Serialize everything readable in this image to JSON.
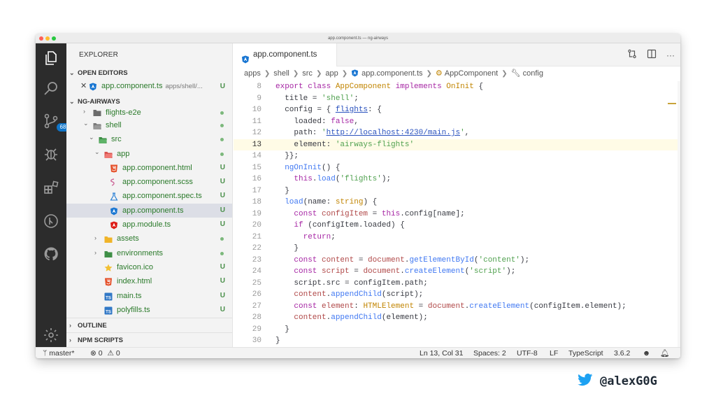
{
  "window": {
    "title": "app.component.ts — ng-airways"
  },
  "activity_bar": {
    "scm_badge": "68"
  },
  "sidebar": {
    "title": "EXPLORER",
    "open_editors": {
      "header": "OPEN EDITORS",
      "items": [
        {
          "close": "✕",
          "name": "app.component.ts",
          "path": "apps/shell/...",
          "status": "U"
        }
      ]
    },
    "project": {
      "header": "NG-AIRWAYS",
      "rows": [
        {
          "name": "flights-e2e",
          "chev": "›",
          "type": "folder"
        },
        {
          "name": "shell",
          "chev": "⌄",
          "type": "folder-open"
        },
        {
          "name": "src",
          "chev": "⌄",
          "type": "folder-open-src"
        },
        {
          "name": "app",
          "chev": "⌄",
          "type": "folder-app"
        },
        {
          "name": "app.component.html",
          "type": "html",
          "status": "U"
        },
        {
          "name": "app.component.scss",
          "type": "scss",
          "status": "U"
        },
        {
          "name": "app.component.spec.ts",
          "type": "spec",
          "status": "U"
        },
        {
          "name": "app.component.ts",
          "type": "angular-ts",
          "status": "U",
          "selected": true
        },
        {
          "name": "app.module.ts",
          "type": "angular",
          "status": "U"
        },
        {
          "name": "assets",
          "chev": "›",
          "type": "folder-assets"
        },
        {
          "name": "environments",
          "chev": "›",
          "type": "folder-env"
        },
        {
          "name": "favicon.ico",
          "type": "favicon",
          "status": "U"
        },
        {
          "name": "index.html",
          "type": "html",
          "status": "U"
        },
        {
          "name": "main.ts",
          "type": "ts",
          "status": "U"
        },
        {
          "name": "polyfills.ts",
          "type": "ts",
          "status": "U"
        }
      ]
    },
    "outline": "OUTLINE",
    "npm_scripts": "NPM SCRIPTS"
  },
  "editor": {
    "tab": {
      "label": "app.component.ts"
    },
    "breadcrumb": [
      "apps",
      "shell",
      "src",
      "app",
      "app.component.ts",
      "AppComponent",
      "config"
    ],
    "current_line": 13,
    "lines": [
      {
        "n": "8",
        "tokens": [
          [
            "kw",
            "export class "
          ],
          [
            "cls",
            "AppComponent "
          ],
          [
            "kw",
            "implements "
          ],
          [
            "cls",
            "OnInit"
          ],
          [
            "p",
            " {"
          ]
        ]
      },
      {
        "n": "9",
        "tokens": [
          [
            "p",
            "  title = "
          ],
          [
            "str",
            "'shell'"
          ],
          [
            "p",
            ";"
          ]
        ]
      },
      {
        "n": "10",
        "tokens": [
          [
            "p",
            "  config = { "
          ],
          [
            "link",
            "flights"
          ],
          [
            "p",
            ": {"
          ]
        ]
      },
      {
        "n": "11",
        "tokens": [
          [
            "p",
            "    loaded: "
          ],
          [
            "kw",
            "false"
          ],
          [
            "p",
            ","
          ]
        ]
      },
      {
        "n": "12",
        "tokens": [
          [
            "p",
            "    path: "
          ],
          [
            "str",
            "'"
          ],
          [
            "link",
            "http://localhost:4230/main.js"
          ],
          [
            "str",
            "'"
          ],
          [
            "p",
            ","
          ]
        ]
      },
      {
        "n": "13",
        "tokens": [
          [
            "p",
            "    element: "
          ],
          [
            "str",
            "'airways-flights'"
          ]
        ]
      },
      {
        "n": "14",
        "tokens": [
          [
            "p",
            "  }};"
          ]
        ]
      },
      {
        "n": "15",
        "tokens": [
          [
            "fn",
            "  ngOnInit"
          ],
          [
            "p",
            "() {"
          ]
        ]
      },
      {
        "n": "16",
        "tokens": [
          [
            "kw",
            "    this"
          ],
          [
            "p",
            "."
          ],
          [
            "fn",
            "load"
          ],
          [
            "p",
            "("
          ],
          [
            "str",
            "'flights'"
          ],
          [
            "p",
            ");"
          ]
        ]
      },
      {
        "n": "17",
        "tokens": [
          [
            "p",
            "  }"
          ]
        ]
      },
      {
        "n": "18",
        "tokens": [
          [
            "fn",
            "  load"
          ],
          [
            "p",
            "(name: "
          ],
          [
            "cls",
            "string"
          ],
          [
            "p",
            ") {"
          ]
        ]
      },
      {
        "n": "19",
        "tokens": [
          [
            "kw",
            "    const "
          ],
          [
            "var",
            "configItem"
          ],
          [
            "p",
            " = "
          ],
          [
            "kw",
            "this"
          ],
          [
            "p",
            ".config[name];"
          ]
        ]
      },
      {
        "n": "20",
        "tokens": [
          [
            "kw",
            "    if "
          ],
          [
            "p",
            "(configItem.loaded) {"
          ]
        ]
      },
      {
        "n": "21",
        "tokens": [
          [
            "kw",
            "      return"
          ],
          [
            "p",
            ";"
          ]
        ]
      },
      {
        "n": "22",
        "tokens": [
          [
            "p",
            "    }"
          ]
        ]
      },
      {
        "n": "23",
        "tokens": [
          [
            "kw",
            "    const "
          ],
          [
            "var",
            "content"
          ],
          [
            "p",
            " = "
          ],
          [
            "var",
            "document"
          ],
          [
            "p",
            "."
          ],
          [
            "fn",
            "getElementById"
          ],
          [
            "p",
            "("
          ],
          [
            "str",
            "'content'"
          ],
          [
            "p",
            ");"
          ]
        ]
      },
      {
        "n": "24",
        "tokens": [
          [
            "kw",
            "    const "
          ],
          [
            "var",
            "script"
          ],
          [
            "p",
            " = "
          ],
          [
            "var",
            "document"
          ],
          [
            "p",
            "."
          ],
          [
            "fn",
            "createElement"
          ],
          [
            "p",
            "("
          ],
          [
            "str",
            "'script'"
          ],
          [
            "p",
            ");"
          ]
        ]
      },
      {
        "n": "25",
        "tokens": [
          [
            "p",
            "    script.src = configItem.path;"
          ]
        ]
      },
      {
        "n": "26",
        "tokens": [
          [
            "p",
            "    "
          ],
          [
            "var",
            "content"
          ],
          [
            "p",
            "."
          ],
          [
            "fn",
            "appendChild"
          ],
          [
            "p",
            "(script);"
          ]
        ]
      },
      {
        "n": "27",
        "tokens": [
          [
            "kw",
            "    const "
          ],
          [
            "var",
            "element"
          ],
          [
            "p",
            ": "
          ],
          [
            "cls",
            "HTMLElement"
          ],
          [
            "p",
            " = "
          ],
          [
            "var",
            "document"
          ],
          [
            "p",
            "."
          ],
          [
            "fn",
            "createElement"
          ],
          [
            "p",
            "(configItem.element);"
          ]
        ]
      },
      {
        "n": "28",
        "tokens": [
          [
            "p",
            "    "
          ],
          [
            "var",
            "content"
          ],
          [
            "p",
            "."
          ],
          [
            "fn",
            "appendChild"
          ],
          [
            "p",
            "(element);"
          ]
        ]
      },
      {
        "n": "29",
        "tokens": [
          [
            "p",
            "  }"
          ]
        ]
      },
      {
        "n": "30",
        "tokens": [
          [
            "p",
            "}"
          ]
        ]
      }
    ]
  },
  "statusbar": {
    "branch": "master*",
    "errors": "0",
    "warnings": "0",
    "position": "Ln 13, Col 31",
    "spaces": "Spaces: 2",
    "encoding": "UTF-8",
    "eol": "LF",
    "language": "TypeScript",
    "version": "3.6.2"
  },
  "handle": "@alexG0G",
  "colors": {
    "keyword": "#a626a4",
    "class": "#c18401",
    "string": "#50a14f",
    "function": "#4078f2",
    "variable": "#b04848",
    "link": "#2a52be",
    "twitter": "#1da1f2"
  }
}
